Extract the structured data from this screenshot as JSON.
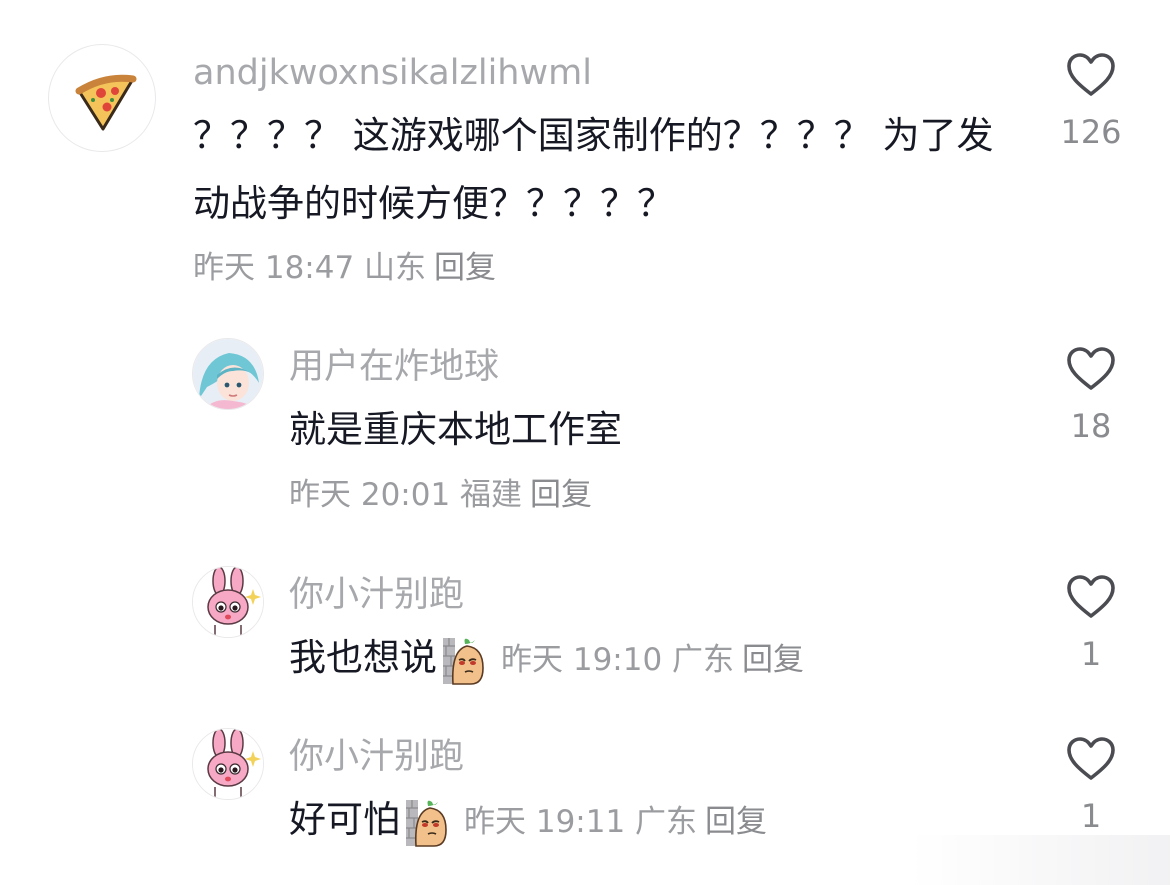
{
  "comments": [
    {
      "username": "andjkwoxnsikalzlihwml",
      "avatar_icon": "pizza-slice-icon",
      "text_line1": "？？？？ 这游戏哪个国家制作的？？？？ 为了发",
      "text_line2": "动战争的时候方便？？？？？",
      "meta": "昨天 18:47 山东",
      "reply": "回复",
      "likes": "126"
    },
    {
      "username": "用户在炸地球",
      "avatar_icon": "anime-girl-avatar",
      "text": "就是重庆本地工作室",
      "meta": "昨天 20:01 福建",
      "reply": "回复",
      "likes": "18"
    },
    {
      "username": "你小汁别跑",
      "avatar_icon": "pink-bunny-avatar",
      "text": "我也想说",
      "emote_icon": "peeking-peanut-emote",
      "meta": "昨天 19:10 广东",
      "reply": "回复",
      "likes": "1"
    },
    {
      "username": "你小汁别跑",
      "avatar_icon": "pink-bunny-avatar",
      "text": "好可怕",
      "emote_icon": "peeking-peanut-emote",
      "meta": "昨天 19:11 广东",
      "reply": "回复",
      "likes": "1"
    }
  ],
  "colors": {
    "username": "#a7a8ac",
    "text": "#161823",
    "meta": "#9b9ca0"
  }
}
